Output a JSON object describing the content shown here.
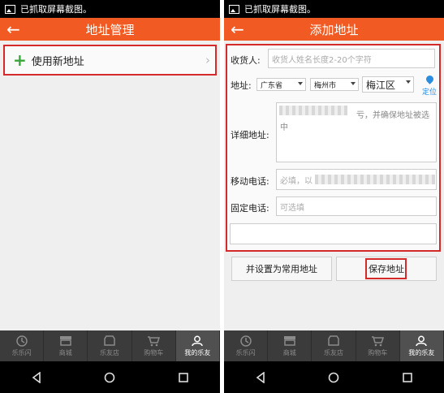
{
  "status_text": "已抓取屏幕截图。",
  "left": {
    "title": "地址管理",
    "new_address_label": "使用新地址"
  },
  "right": {
    "title": "添加地址",
    "form": {
      "recipient_label": "收货人:",
      "recipient_placeholder": "收货人姓名长度2-20个字符",
      "address_label": "地址:",
      "province": "广东省",
      "city": "梅州市",
      "district": "梅江区",
      "locate_label": "定位",
      "detail_label": "详细地址:",
      "detail_hint": "亏，并确保地址被选",
      "detail_hint2": "中",
      "mobile_label": "移动电话:",
      "mobile_placeholder": "必填，以",
      "phone_label": "固定电话:",
      "phone_placeholder": "可选填"
    },
    "buttons": {
      "set_default": "并设置为常用地址",
      "save": "保存地址"
    }
  },
  "tabs": [
    {
      "label": "乐乐闪",
      "icon": "clock-icon"
    },
    {
      "label": "商城",
      "icon": "store-icon"
    },
    {
      "label": "乐友店",
      "icon": "shop-icon"
    },
    {
      "label": "购物车",
      "icon": "cart-icon"
    },
    {
      "label": "我的乐友",
      "icon": "user-icon",
      "active": true
    }
  ],
  "colors": {
    "accent": "#f15a22",
    "highlight": "#d42a2a",
    "locate": "#2a8de0"
  }
}
